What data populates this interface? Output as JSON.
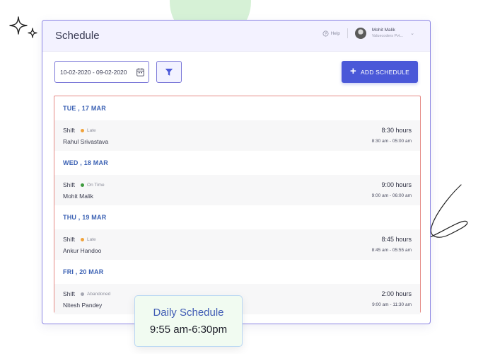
{
  "header": {
    "title": "Schedule",
    "help_label": "Help",
    "user_name": "Mohit Malik",
    "user_org": "Valuecoders Pvt..."
  },
  "toolbar": {
    "date_range": "10-02-2020 - 09-02-2020",
    "add_label": "ADD SCHEDULE"
  },
  "days": [
    {
      "label": "TUE , 17 MAR",
      "shift": "Shift",
      "status": "Late",
      "status_color": "#f0a23a",
      "name": "Rahul Srivastava",
      "hours": "8:30 hours",
      "range": "8:30 am - 05:00 am"
    },
    {
      "label": "WED , 18 MAR",
      "shift": "Shift",
      "status": "On Time",
      "status_color": "#3e9b3e",
      "name": "Mohit Malik",
      "hours": "9:00 hours",
      "range": "9:00 am - 06:00 am"
    },
    {
      "label": "THU , 19 MAR",
      "shift": "Shift",
      "status": "Late",
      "status_color": "#f0a23a",
      "name": "Ankur Handoo",
      "hours": "8:45 hours",
      "range": "8:45 am - 05:55 am"
    },
    {
      "label": "FRI , 20 MAR",
      "shift": "Shift",
      "status": "Abandoned",
      "status_color": "#a5a7b2",
      "name": "Nitesh Pandey",
      "hours": "2:00 hours",
      "range": "9:00 am - 11:30 am"
    }
  ],
  "tooltip": {
    "title": "Daily Schedule",
    "time": "9:55 am-6:30pm"
  },
  "colors": {
    "accent": "#4a58d8",
    "border": "#8a84e3",
    "list_border": "#e58a85",
    "day_header": "#3c62b4"
  }
}
